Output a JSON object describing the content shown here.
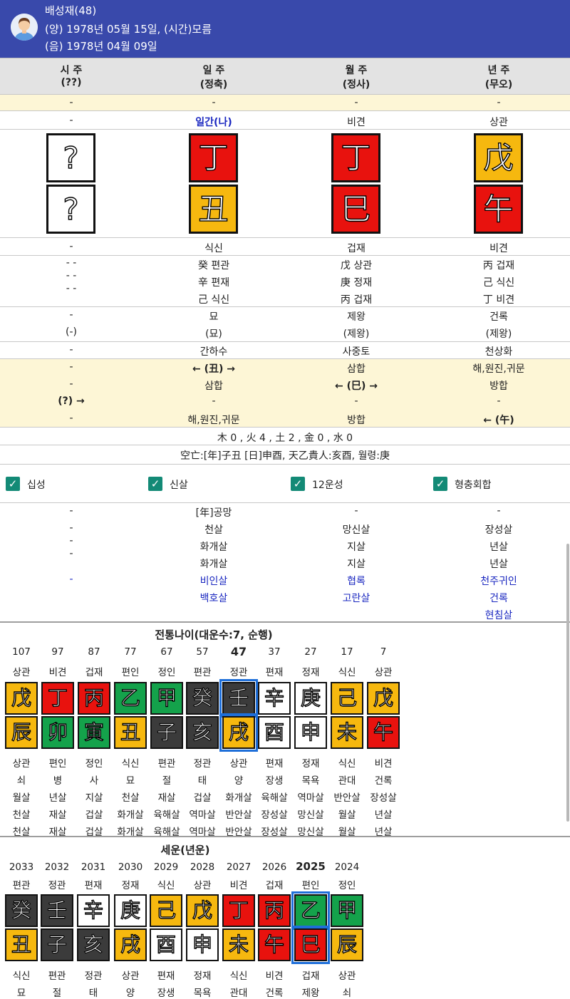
{
  "header": {
    "name": "배성재(48)",
    "solar": "(양) 1978년 05월 15일, (시간)모름",
    "lunar": "(음) 1978년 04월 09일"
  },
  "pillars": [
    {
      "title": "시 주",
      "sub": "(??)",
      "ganzhi_top": "?",
      "ganzhi_bot": "?",
      "top_color": "white",
      "bot_color": "white"
    },
    {
      "title": "일 주",
      "sub": "(정축)",
      "ganzhi_top": "丁",
      "ganzhi_bot": "丑",
      "top_color": "red",
      "bot_color": "yellow"
    },
    {
      "title": "월 주",
      "sub": "(정사)",
      "ganzhi_top": "丁",
      "ganzhi_bot": "巳",
      "top_color": "red",
      "bot_color": "red"
    },
    {
      "title": "년 주",
      "sub": "(무오)",
      "ganzhi_top": "戊",
      "ganzhi_bot": "午",
      "top_color": "yellow",
      "bot_color": "red"
    }
  ],
  "rows": {
    "yellow_dash": [
      "-",
      "-",
      "-",
      "-"
    ],
    "sipsin_top": [
      "-",
      "일간(나)",
      "비견",
      "상관"
    ],
    "sipsin_bot": [
      "-",
      "식신",
      "겁재",
      "비견"
    ],
    "jijanggan": [
      [
        "- -",
        "- -",
        "- -"
      ],
      [
        "癸 편관",
        "辛 편재",
        "己 식신"
      ],
      [
        "戊 상관",
        "庚 정재",
        "丙 겁재"
      ],
      [
        "丙 겁재",
        "己 식신",
        "丁 비견"
      ]
    ],
    "unseong_a": [
      "-",
      "묘",
      "제왕",
      "건록"
    ],
    "unseong_b": [
      "(-)",
      "(묘)",
      "(제왕)",
      "(제왕)"
    ],
    "napeum": [
      "-",
      "간하수",
      "사중토",
      "천상화"
    ],
    "hap": [
      [
        "-",
        "-",
        "(?) →",
        "-"
      ],
      [
        "← (丑) →",
        "삼합",
        "-",
        "해,원진,귀문"
      ],
      [
        "삼합",
        "← (巳) →",
        "-",
        "방합"
      ],
      [
        "해,원진,귀문",
        "방합",
        "-",
        "← (午)"
      ]
    ],
    "ohaeng": "木 0 , 火 4 , 土 2 , 金 0 , 水 0",
    "gongmang": "空亡:[年]子丑 [日]申酉, 天乙貴人:亥酉, 월령:庚"
  },
  "checkboxes": [
    "십성",
    "신살",
    "12운성",
    "형충회합"
  ],
  "sinsal": [
    {
      "black": [
        "-",
        "-",
        "-",
        "-"
      ],
      "blue": [
        "-"
      ]
    },
    {
      "black": [
        "[年]공망",
        "천살",
        "화개살",
        "화개살"
      ],
      "blue": [
        "비인살",
        "백호살"
      ]
    },
    {
      "black": [
        "-",
        "망신살",
        "지살",
        "지살"
      ],
      "blue": [
        "협록",
        "고란살"
      ]
    },
    {
      "black": [
        "-",
        "장성살",
        "년살",
        "년살"
      ],
      "blue": [
        "천주귀인",
        "건록",
        "현침살"
      ]
    }
  ],
  "daeun": {
    "title": "전통나이(대운수:7, 순행)",
    "ages": [
      "107",
      "97",
      "87",
      "77",
      "67",
      "57",
      "47",
      "37",
      "27",
      "17",
      "7"
    ],
    "sipsin_top": [
      "상관",
      "비견",
      "겁재",
      "편인",
      "정인",
      "편관",
      "정관",
      "편재",
      "정재",
      "식신",
      "상관"
    ],
    "stems": [
      "戊",
      "丁",
      "丙",
      "乙",
      "甲",
      "癸",
      "壬",
      "辛",
      "庚",
      "己",
      "戊"
    ],
    "branches": [
      "辰",
      "卯",
      "寅",
      "丑",
      "子",
      "亥",
      "戌",
      "酉",
      "申",
      "未",
      "午"
    ],
    "stem_colors": [
      "yellow",
      "red",
      "red",
      "green",
      "green",
      "black",
      "black",
      "white",
      "white",
      "yellow",
      "yellow"
    ],
    "branch_colors": [
      "yellow",
      "green",
      "green",
      "yellow",
      "black",
      "black",
      "yellow",
      "white",
      "white",
      "yellow",
      "red"
    ],
    "selected": 6,
    "rows": [
      [
        "상관",
        "편인",
        "정인",
        "식신",
        "편관",
        "정관",
        "상관",
        "편재",
        "정재",
        "식신",
        "비견"
      ],
      [
        "쇠",
        "병",
        "사",
        "묘",
        "절",
        "태",
        "양",
        "장생",
        "목욕",
        "관대",
        "건록"
      ],
      [
        "월살",
        "년살",
        "지살",
        "천살",
        "재살",
        "겁살",
        "화개살",
        "육해살",
        "역마살",
        "반안살",
        "장성살"
      ],
      [
        "천살",
        "재살",
        "겁살",
        "화개살",
        "육해살",
        "역마살",
        "반안살",
        "장성살",
        "망신살",
        "월살",
        "년살"
      ],
      [
        "천살",
        "재살",
        "겁살",
        "화개살",
        "육해살",
        "역마살",
        "반안살",
        "장성살",
        "망신살",
        "월살",
        "년살"
      ]
    ]
  },
  "seun": {
    "title": "세운(년운)",
    "years": [
      "2033",
      "2032",
      "2031",
      "2030",
      "2029",
      "2028",
      "2027",
      "2026",
      "2025",
      "2024"
    ],
    "sipsin_top": [
      "편관",
      "정관",
      "편재",
      "정재",
      "식신",
      "상관",
      "비견",
      "겁재",
      "편인",
      "정인"
    ],
    "stems": [
      "癸",
      "壬",
      "辛",
      "庚",
      "己",
      "戊",
      "丁",
      "丙",
      "乙",
      "甲"
    ],
    "branches": [
      "丑",
      "子",
      "亥",
      "戌",
      "酉",
      "申",
      "未",
      "午",
      "巳",
      "辰"
    ],
    "stem_colors": [
      "black",
      "black",
      "white",
      "white",
      "yellow",
      "yellow",
      "red",
      "red",
      "green",
      "green"
    ],
    "branch_colors": [
      "yellow",
      "black",
      "black",
      "yellow",
      "white",
      "white",
      "yellow",
      "red",
      "red",
      "yellow"
    ],
    "selected": 8,
    "rows": [
      [
        "식신",
        "편관",
        "정관",
        "상관",
        "편재",
        "정재",
        "식신",
        "비견",
        "겁재",
        "상관"
      ],
      [
        "묘",
        "절",
        "태",
        "양",
        "장생",
        "목욕",
        "관대",
        "건록",
        "제왕",
        "쇠"
      ]
    ]
  }
}
